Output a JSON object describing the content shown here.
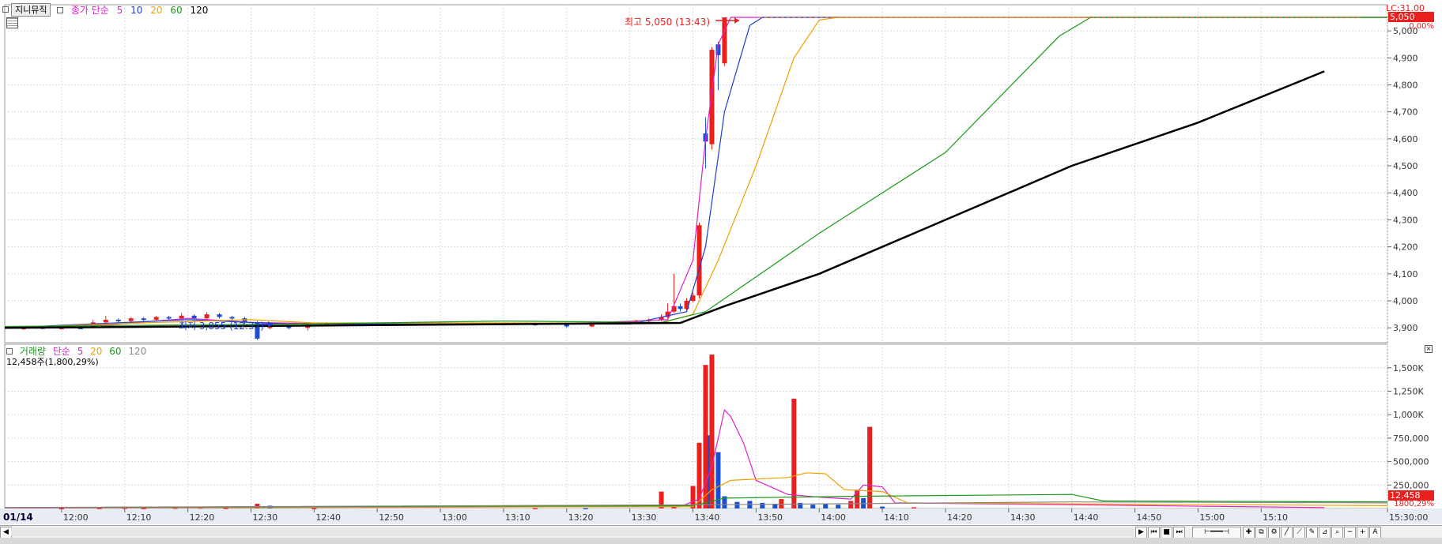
{
  "header": {
    "symbol": "지니뮤직",
    "ma_label": "종가 단순",
    "ma_periods": [
      {
        "label": "5",
        "color": "#e020c8"
      },
      {
        "label": "10",
        "color": "#1a3fd0"
      },
      {
        "label": "20",
        "color": "#f0a000"
      },
      {
        "label": "60",
        "color": "#1a9a1a"
      },
      {
        "label": "120",
        "color": "#000000"
      }
    ],
    "lc_label": "LC:31.00"
  },
  "volume_header": {
    "label": "거래량",
    "ma_label": "단순",
    "ma_periods": [
      {
        "label": "5",
        "color": "#e020c8"
      },
      {
        "label": "20",
        "color": "#f0a000"
      },
      {
        "label": "60",
        "color": "#1a9a1a"
      },
      {
        "label": "120",
        "color": "#888888"
      }
    ],
    "current_value": "12,458주(1,800,29%)"
  },
  "annotations": {
    "high": "최고 5,050 (13:43)",
    "low": "최저 3,855 (12:32)"
  },
  "badges": {
    "price": "5,050",
    "price_change": "0,00%",
    "volume": "12,458",
    "volume_pct": "1800,29%"
  },
  "date_label": "01/14",
  "colors": {
    "up": "#e8201e",
    "down": "#1a4fd0",
    "grid": "#d9d9d9"
  },
  "chart_data": [
    {
      "type": "candlestick",
      "title": "",
      "x_ticks": [
        "12:00",
        "12:10",
        "12:20",
        "12:30",
        "12:40",
        "12:50",
        "13:00",
        "13:10",
        "13:20",
        "13:30",
        "13:40",
        "13:50",
        "14:00",
        "14:10",
        "14:20",
        "14:30",
        "14:40",
        "14:50",
        "15:00",
        "15:10",
        "15:30:00"
      ],
      "y_ticks": [
        3900,
        4000,
        4100,
        4200,
        4300,
        4400,
        4500,
        4600,
        4700,
        4800,
        4900,
        5000
      ],
      "ylim": [
        3845,
        5050
      ],
      "series": [
        {
          "name": "5",
          "color": "#e020c8",
          "points": [
            [
              "11:51",
              3900
            ],
            [
              "12:08",
              3912
            ],
            [
              "12:20",
              3935
            ],
            [
              "12:30",
              3920
            ],
            [
              "12:50",
              3912
            ],
            [
              "13:20",
              3915
            ],
            [
              "13:36",
              3930
            ],
            [
              "13:40",
              4150
            ],
            [
              "13:42",
              4600
            ],
            [
              "13:44",
              4950
            ],
            [
              "13:46",
              5050
            ],
            [
              "15:30",
              5050
            ]
          ]
        },
        {
          "name": "10",
          "color": "#1a3fd0",
          "points": [
            [
              "11:51",
              3900
            ],
            [
              "12:20",
              3930
            ],
            [
              "12:35",
              3915
            ],
            [
              "13:30",
              3914
            ],
            [
              "13:39",
              3960
            ],
            [
              "13:42",
              4200
            ],
            [
              "13:45",
              4700
            ],
            [
              "13:49",
              5020
            ],
            [
              "13:51",
              5050
            ],
            [
              "15:30",
              5050
            ]
          ]
        },
        {
          "name": "20",
          "color": "#f0a000",
          "points": [
            [
              "11:51",
              3900
            ],
            [
              "12:15",
              3920
            ],
            [
              "12:30",
              3930
            ],
            [
              "12:40",
              3918
            ],
            [
              "13:35",
              3918
            ],
            [
              "13:40",
              3950
            ],
            [
              "13:44",
              4150
            ],
            [
              "13:50",
              4500
            ],
            [
              "13:56",
              4900
            ],
            [
              "14:00",
              5040
            ],
            [
              "14:03",
              5050
            ],
            [
              "15:30",
              5050
            ]
          ]
        },
        {
          "name": "60",
          "color": "#1a9a1a",
          "points": [
            [
              "11:51",
              3905
            ],
            [
              "12:40",
              3915
            ],
            [
              "13:10",
              3925
            ],
            [
              "13:35",
              3920
            ],
            [
              "13:42",
              3960
            ],
            [
              "14:00",
              4250
            ],
            [
              "14:20",
              4550
            ],
            [
              "14:38",
              4980
            ],
            [
              "14:43",
              5050
            ],
            [
              "15:30",
              5050
            ]
          ]
        },
        {
          "name": "120",
          "color": "#000000",
          "points": [
            [
              "11:51",
              3900
            ],
            [
              "13:38",
              3918
            ],
            [
              "13:45",
              3980
            ],
            [
              "14:00",
              4100
            ],
            [
              "14:20",
              4300
            ],
            [
              "14:40",
              4500
            ],
            [
              "15:00",
              4660
            ],
            [
              "15:20",
              4850
            ]
          ]
        }
      ],
      "candles": [
        [
          "11:54",
          3895,
          3902,
          3892,
          3906
        ],
        [
          "11:57",
          3902,
          3899,
          3895,
          3905
        ],
        [
          "12:00",
          3899,
          3901,
          3894,
          3905
        ],
        [
          "12:03",
          3901,
          3900,
          3896,
          3906
        ],
        [
          "12:05",
          3900,
          3920,
          3898,
          3930
        ],
        [
          "12:07",
          3920,
          3930,
          3915,
          3945
        ],
        [
          "12:09",
          3930,
          3925,
          3920,
          3935
        ],
        [
          "12:11",
          3925,
          3935,
          3920,
          3940
        ],
        [
          "12:13",
          3935,
          3930,
          3925,
          3940
        ],
        [
          "12:15",
          3930,
          3940,
          3925,
          3945
        ],
        [
          "12:17",
          3940,
          3935,
          3930,
          3945
        ],
        [
          "12:19",
          3935,
          3945,
          3930,
          3955
        ],
        [
          "12:21",
          3945,
          3935,
          3930,
          3950
        ],
        [
          "12:23",
          3935,
          3950,
          3930,
          3958
        ],
        [
          "12:25",
          3950,
          3940,
          3935,
          3955
        ],
        [
          "12:27",
          3940,
          3935,
          3925,
          3945
        ],
        [
          "12:29",
          3935,
          3920,
          3915,
          3940
        ],
        [
          "12:31",
          3920,
          3860,
          3855,
          3925
        ],
        [
          "12:33",
          3900,
          3905,
          3895,
          3910
        ],
        [
          "12:36",
          3905,
          3900,
          3895,
          3908
        ],
        [
          "12:39",
          3900,
          3910,
          3890,
          3915
        ],
        [
          "12:42",
          3910,
          3915,
          3905,
          3920
        ],
        [
          "12:46",
          3915,
          3912,
          3908,
          3920
        ],
        [
          "12:50",
          3912,
          3915,
          3908,
          3920
        ],
        [
          "12:55",
          3915,
          3913,
          3908,
          3918
        ],
        [
          "13:00",
          3913,
          3916,
          3910,
          3920
        ],
        [
          "13:05",
          3916,
          3914,
          3910,
          3920
        ],
        [
          "13:10",
          3914,
          3915,
          3910,
          3920
        ],
        [
          "13:15",
          3915,
          3913,
          3908,
          3918
        ],
        [
          "13:20",
          3913,
          3905,
          3900,
          3918
        ],
        [
          "13:24",
          3905,
          3915,
          3902,
          3920
        ],
        [
          "13:28",
          3915,
          3918,
          3912,
          3922
        ],
        [
          "13:31",
          3918,
          3925,
          3915,
          3930
        ],
        [
          "13:33",
          3925,
          3930,
          3920,
          3935
        ],
        [
          "13:35",
          3930,
          3940,
          3925,
          3950
        ],
        [
          "13:36",
          3940,
          3960,
          3935,
          3990
        ],
        [
          "13:37",
          3960,
          3980,
          3955,
          4100
        ],
        [
          "13:38",
          3980,
          3970,
          3960,
          3990
        ],
        [
          "13:39",
          3970,
          4000,
          3965,
          4010
        ],
        [
          "13:40",
          4000,
          4020,
          3995,
          4030
        ],
        [
          "13:41",
          4020,
          4280,
          4010,
          4290
        ],
        [
          "13:42",
          4620,
          4590,
          4490,
          4680
        ],
        [
          "13:43",
          4580,
          4930,
          4560,
          4940
        ],
        [
          "13:44",
          4950,
          4910,
          4780,
          4960
        ],
        [
          "13:45",
          4880,
          5050,
          4870,
          5050
        ]
      ]
    },
    {
      "type": "bar",
      "title": "",
      "y_ticks": [
        "250,000",
        "500,000",
        "750,000",
        "1,000K",
        "1,250K",
        "1,500K"
      ],
      "ylim": [
        0,
        1700000
      ],
      "series": [
        {
          "name": "5",
          "color": "#e020c8",
          "points": [
            [
              "11:51",
              5000
            ],
            [
              "13:38",
              20000
            ],
            [
              "13:41",
              100000
            ],
            [
              "13:43",
              450000
            ],
            [
              "13:44",
              750000
            ],
            [
              "13:45",
              1050000
            ],
            [
              "13:46",
              980000
            ],
            [
              "13:48",
              700000
            ],
            [
              "13:50",
              300000
            ],
            [
              "13:55",
              150000
            ],
            [
              "14:00",
              120000
            ],
            [
              "14:05",
              100000
            ],
            [
              "14:07",
              250000
            ],
            [
              "14:10",
              230000
            ],
            [
              "14:12",
              60000
            ],
            [
              "15:20",
              10000
            ]
          ]
        },
        {
          "name": "20",
          "color": "#f0a000",
          "points": [
            [
              "11:51",
              8000
            ],
            [
              "13:40",
              20000
            ],
            [
              "13:43",
              200000
            ],
            [
              "13:46",
              300000
            ],
            [
              "13:55",
              330000
            ],
            [
              "13:58",
              380000
            ],
            [
              "14:01",
              370000
            ],
            [
              "14:04",
              200000
            ],
            [
              "14:10",
              180000
            ],
            [
              "14:14",
              60000
            ],
            [
              "15:30",
              30000
            ]
          ]
        },
        {
          "name": "60",
          "color": "#1a9a1a",
          "points": [
            [
              "11:51",
              10000
            ],
            [
              "13:40",
              30000
            ],
            [
              "13:45",
              110000
            ],
            [
              "14:05",
              130000
            ],
            [
              "14:40",
              150000
            ],
            [
              "14:45",
              80000
            ],
            [
              "15:30",
              70000
            ]
          ]
        },
        {
          "name": "120",
          "color": "#888888",
          "points": [
            [
              "11:51",
              10000
            ],
            [
              "13:45",
              40000
            ],
            [
              "14:40",
              70000
            ],
            [
              "15:30",
              60000
            ]
          ]
        }
      ],
      "bars": [
        [
          "12:00",
          4000,
          "up"
        ],
        [
          "12:06",
          6000,
          "up"
        ],
        [
          "12:10",
          8000,
          "up"
        ],
        [
          "12:13",
          5000,
          "up"
        ],
        [
          "12:18",
          9000,
          "up"
        ],
        [
          "12:22",
          11000,
          "up"
        ],
        [
          "12:26",
          7000,
          "up"
        ],
        [
          "12:31",
          50000,
          "up"
        ],
        [
          "12:33",
          30000,
          "down"
        ],
        [
          "12:40",
          4000,
          "up"
        ],
        [
          "13:15",
          5000,
          "up"
        ],
        [
          "13:23",
          4000,
          "down"
        ],
        [
          "13:35",
          180000,
          "up"
        ],
        [
          "13:37",
          20000,
          "up"
        ],
        [
          "13:40",
          240000,
          "up"
        ],
        [
          "13:41",
          700000,
          "up"
        ],
        [
          "13:42",
          1530000,
          "up"
        ],
        [
          "13:42.7",
          780000,
          "down"
        ],
        [
          "13:43",
          1640000,
          "up"
        ],
        [
          "13:44",
          600000,
          "down"
        ],
        [
          "13:45",
          130000,
          "down"
        ],
        [
          "13:47",
          70000,
          "down"
        ],
        [
          "13:49",
          80000,
          "down"
        ],
        [
          "13:51",
          60000,
          "down"
        ],
        [
          "13:53",
          50000,
          "down"
        ],
        [
          "13:54",
          100000,
          "up"
        ],
        [
          "13:56",
          1170000,
          "up"
        ],
        [
          "13:57",
          60000,
          "down"
        ],
        [
          "13:59",
          40000,
          "down"
        ],
        [
          "14:01",
          50000,
          "down"
        ],
        [
          "14:03",
          40000,
          "down"
        ],
        [
          "14:05",
          80000,
          "up"
        ],
        [
          "14:06",
          200000,
          "up"
        ],
        [
          "14:07",
          110000,
          "down"
        ],
        [
          "14:08",
          870000,
          "up"
        ],
        [
          "14:10",
          20000,
          "down"
        ],
        [
          "14:15",
          12458,
          "up"
        ]
      ]
    }
  ]
}
